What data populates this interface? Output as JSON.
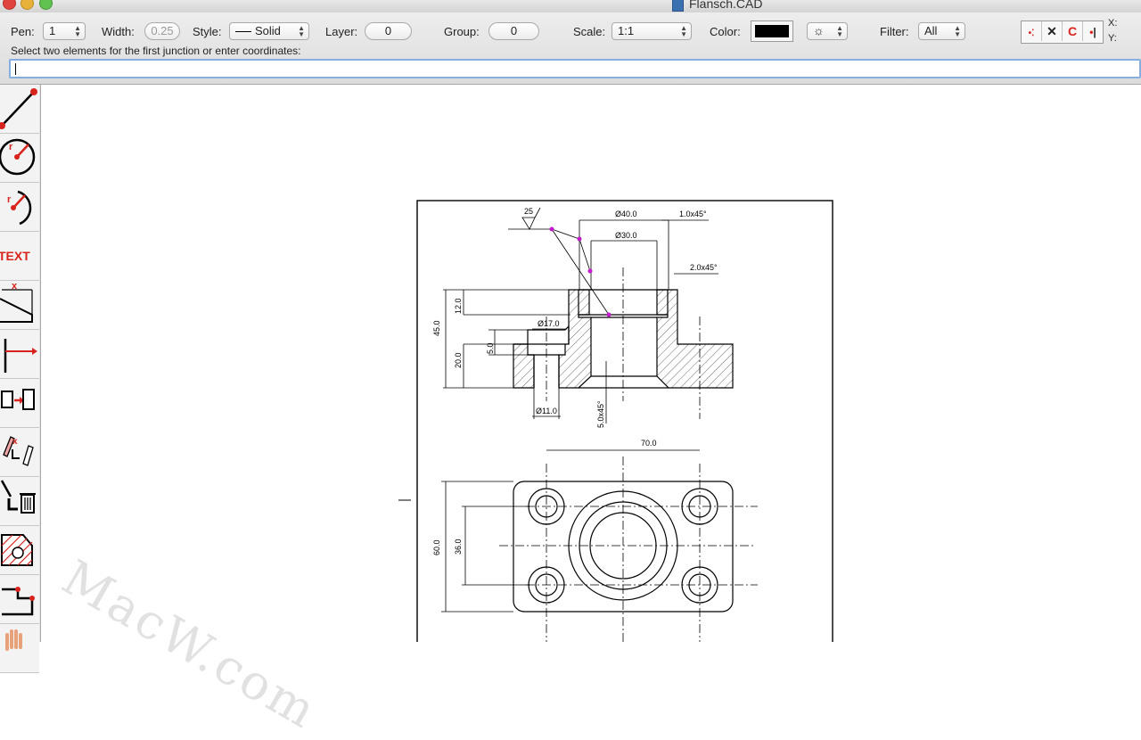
{
  "window": {
    "title": "Flansch.CAD"
  },
  "toolbar": {
    "pen_label": "Pen:",
    "pen_value": "1",
    "width_label": "Width:",
    "width_value": "0.25",
    "style_label": "Style:",
    "style_value": "Solid",
    "layer_label": "Layer:",
    "layer_value": "0",
    "group_label": "Group:",
    "group_value": "0",
    "scale_label": "Scale:",
    "scale_value": "1:1",
    "color_label": "Color:",
    "color_value": "#000000",
    "filter_label": "Filter:",
    "filter_value": "All",
    "x_label": "X:",
    "y_label": "Y:"
  },
  "command": {
    "prompt": "Select two elements for the first junction or enter coordinates:",
    "input_value": ""
  },
  "palette": {
    "text_tool_label": "TEXT"
  },
  "drawing": {
    "surface_finish": "25",
    "dims": {
      "d40": "Ø40.0",
      "chamfer_top": "1.0x45°",
      "d30": "Ø30.0",
      "chamfer_inner": "2.0x45°",
      "h12": "12.0",
      "h45": "45.0",
      "d17": "Ø17.0",
      "h5": "5.0",
      "h20": "20.0",
      "d11": "Ø11.0",
      "chamfer_bottom": "5.0x45°",
      "w70": "70.0",
      "h60": "60.0",
      "h36": "36.0"
    }
  },
  "watermark": "MacW.com"
}
